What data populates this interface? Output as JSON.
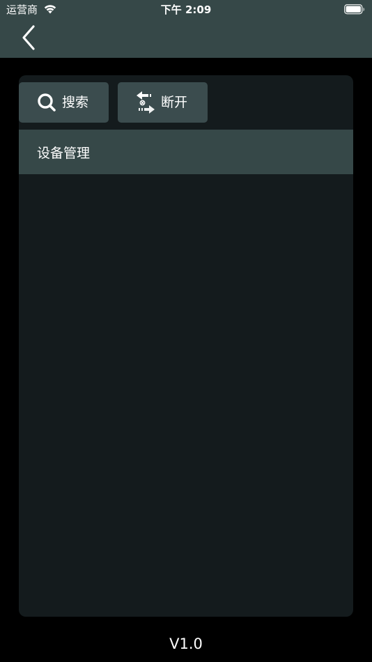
{
  "status_bar": {
    "carrier": "运营商",
    "time": "下午 2:09"
  },
  "nav": {
    "back_icon": "chevron-left-icon"
  },
  "toolbar": {
    "search_label": "搜索",
    "search_icon": "search-icon",
    "disconnect_label": "断开",
    "disconnect_icon": "disconnect-icon"
  },
  "list": {
    "items": [
      {
        "label": "设备管理"
      }
    ]
  },
  "footer": {
    "version": "V1.0"
  },
  "colors": {
    "header_bg": "#364848",
    "panel_bg": "#141b1d",
    "button_bg": "#3b4c4e",
    "page_bg": "#000000"
  }
}
